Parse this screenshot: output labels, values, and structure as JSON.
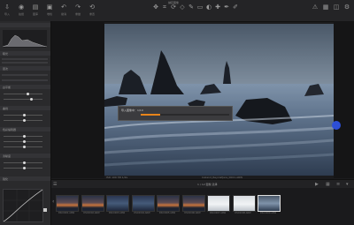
{
  "app": {
    "title": "捕获图像"
  },
  "toolbar": {
    "left_tools": [
      {
        "icon": "import-icon",
        "label": "导入"
      },
      {
        "icon": "camera-icon",
        "label": "拍摄"
      },
      {
        "icon": "folder-icon",
        "label": "图库"
      },
      {
        "icon": "stack-icon",
        "label": "堆栈"
      },
      {
        "icon": "undo-icon",
        "label": "撤消"
      },
      {
        "icon": "redo-icon",
        "label": "重做"
      },
      {
        "icon": "reset-icon",
        "label": "重置"
      }
    ]
  },
  "left_panel": {
    "sections": [
      "曝光",
      "层次",
      "白平衡",
      "曲线",
      "色彩编辑器",
      "清晰度",
      "锐化"
    ],
    "curve_label": "曲线"
  },
  "import_dialog": {
    "title": "导入图像中：1/10",
    "progress": 0.22
  },
  "viewer": {
    "status_left": "ISO 100  f/8  1/2s",
    "status_mid": "Iceland_Reynisfjara_0001.ARW"
  },
  "filmstrip": {
    "title": "1 / 12 图像  选择",
    "thumbnails": [
      {
        "label": "DSC0001.ARW",
        "tone": "sunset"
      },
      {
        "label": "DSC0002.ARW",
        "tone": "sunset"
      },
      {
        "label": "DSC0003.ARW",
        "tone": "blue"
      },
      {
        "label": "DSC0004.ARW",
        "tone": "blue"
      },
      {
        "label": "DSC0005.ARW",
        "tone": "sunset"
      },
      {
        "label": "DSC0006.ARW",
        "tone": "sunset"
      },
      {
        "label": "DSC0007.ARW",
        "tone": "white"
      },
      {
        "label": "DSC0008.ARW",
        "tone": "white"
      },
      {
        "label": "DSC0009.ARW",
        "tone": "seascape",
        "selected": true
      }
    ]
  },
  "colors": {
    "accent": "#e8841a",
    "selection": "#2d4fd6",
    "bg": "#1c1c1e"
  }
}
